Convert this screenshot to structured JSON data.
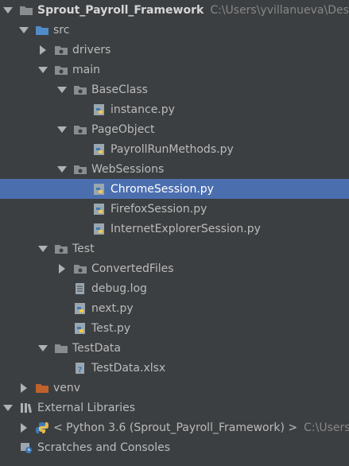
{
  "project": {
    "name": "Sprout_Payroll_Framework",
    "path": "C:\\Users\\yvillanueva\\Desktop"
  },
  "tree": {
    "src": "src",
    "drivers": "drivers",
    "main": "main",
    "baseclass": "BaseClass",
    "instance": "instance.py",
    "pageobject": "PageObject",
    "payrollrun": "PayrollRunMethods.py",
    "websessions": "WebSessions",
    "chromesession": "ChromeSession.py",
    "firefoxsession": "FirefoxSession.py",
    "iesession": "InternetExplorerSession.py",
    "test": "Test",
    "convertedfiles": "ConvertedFiles",
    "debuglog": "debug.log",
    "nextpy": "next.py",
    "testpy": "Test.py",
    "testdata": "TestData",
    "testdataxlsx": "TestData.xlsx",
    "venv": "venv"
  },
  "external_libraries": {
    "label": "External Libraries",
    "python_label": "< Python 3.6 (Sprout_Payroll_Framework) >",
    "python_hint": "C:\\Users\\yv"
  },
  "scratches": {
    "label": "Scratches and Consoles"
  },
  "colors": {
    "background": "#3c3f41",
    "selection": "#4b6eaf",
    "text": "#bbbbbb",
    "hint": "#878787",
    "folder": "#8a8d8f",
    "source_folder": "#4f8cc9",
    "venv_folder": "#c0612b"
  }
}
